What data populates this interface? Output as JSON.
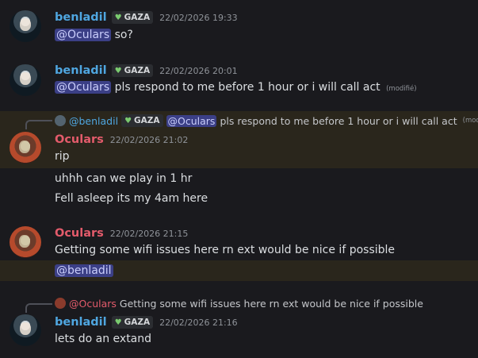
{
  "messages": [
    {
      "user": "benladil",
      "tag": "GAZA",
      "time": "22/02/2026 19:33",
      "mention": "@Oculars",
      "text": "so?"
    },
    {
      "user": "benladil",
      "tag": "GAZA",
      "time": "22/02/2026 20:01",
      "mention": "@Oculars",
      "text": "pls respond to me before 1 hour or i will call act",
      "edited": "(modifié)"
    },
    {
      "reply": {
        "user": "@benladil",
        "tag": "GAZA",
        "mention": "@Oculars",
        "text": "pls respond to me before 1 hour or i will call act",
        "edited": "(modifié)"
      },
      "user": "Oculars",
      "time": "22/02/2026 21:02",
      "text": "rip"
    },
    {
      "text": "uhhh can we play in 1 hr"
    },
    {
      "text": "Fell asleep its my 4am here"
    },
    {
      "user": "Oculars",
      "time": "22/02/2026 21:15",
      "text": "Getting some wifi issues here rn ext would be nice if possible"
    },
    {
      "mention": "@benladil"
    },
    {
      "reply": {
        "user": "@Oculars",
        "text": "Getting some wifi issues here rn ext would be nice if possible"
      },
      "user": "benladil",
      "tag": "GAZA",
      "time": "22/02/2026 21:16",
      "text": "lets do an extand"
    }
  ]
}
